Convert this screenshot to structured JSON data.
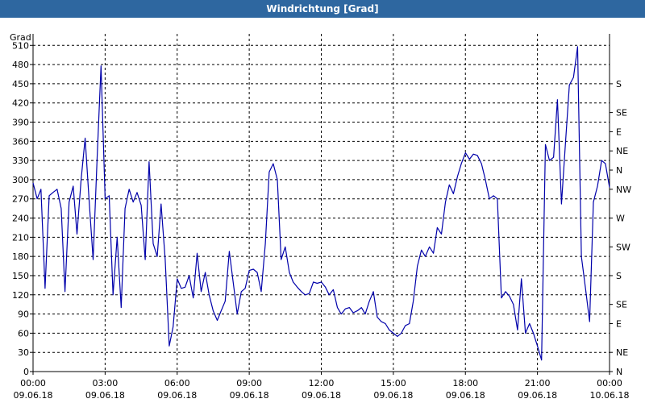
{
  "window": {
    "title": "Windrichtung [Grad]"
  },
  "chart_data": {
    "type": "line",
    "title": "Windrichtung [Grad]",
    "ylabel": "Grad",
    "ylim": [
      0,
      528
    ],
    "xlim_hours": [
      0,
      24
    ],
    "grid": true,
    "line_color": "#0000aa",
    "y_ticks": [
      0,
      30,
      60,
      90,
      120,
      150,
      180,
      210,
      240,
      270,
      300,
      330,
      360,
      390,
      420,
      450,
      480,
      510
    ],
    "right_ticks": [
      {
        "value": 0,
        "label": "N"
      },
      {
        "value": 30,
        "label": "NE"
      },
      {
        "value": 75,
        "label": "E"
      },
      {
        "value": 105,
        "label": "SE"
      },
      {
        "value": 150,
        "label": "S"
      },
      {
        "value": 195,
        "label": "SW"
      },
      {
        "value": 240,
        "label": "W"
      },
      {
        "value": 285,
        "label": "NW"
      },
      {
        "value": 315,
        "label": "N"
      },
      {
        "value": 345,
        "label": "NE"
      },
      {
        "value": 375,
        "label": "E"
      },
      {
        "value": 405,
        "label": "SE"
      },
      {
        "value": 450,
        "label": "S"
      }
    ],
    "x_ticks": [
      {
        "hour": 0,
        "time": "00:00",
        "date": "09.06.18"
      },
      {
        "hour": 3,
        "time": "03:00",
        "date": "09.06.18"
      },
      {
        "hour": 6,
        "time": "06:00",
        "date": "09.06.18"
      },
      {
        "hour": 9,
        "time": "09:00",
        "date": "09.06.18"
      },
      {
        "hour": 12,
        "time": "12:00",
        "date": "09.06.18"
      },
      {
        "hour": 15,
        "time": "15:00",
        "date": "09.06.18"
      },
      {
        "hour": 18,
        "time": "18:00",
        "date": "09.06.18"
      },
      {
        "hour": 21,
        "time": "21:00",
        "date": "09.06.18"
      },
      {
        "hour": 24,
        "time": "00:00",
        "date": "10.06.18"
      }
    ],
    "series": [
      {
        "points": [
          [
            0.0,
            295
          ],
          [
            0.17,
            270
          ],
          [
            0.33,
            285
          ],
          [
            0.5,
            130
          ],
          [
            0.67,
            275
          ],
          [
            0.83,
            280
          ],
          [
            1.0,
            285
          ],
          [
            1.17,
            255
          ],
          [
            1.33,
            125
          ],
          [
            1.5,
            265
          ],
          [
            1.67,
            290
          ],
          [
            1.83,
            215
          ],
          [
            2.0,
            300
          ],
          [
            2.17,
            365
          ],
          [
            2.33,
            270
          ],
          [
            2.5,
            175
          ],
          [
            2.67,
            335
          ],
          [
            2.83,
            478
          ],
          [
            3.0,
            270
          ],
          [
            3.17,
            275
          ],
          [
            3.33,
            120
          ],
          [
            3.5,
            210
          ],
          [
            3.67,
            100
          ],
          [
            3.83,
            255
          ],
          [
            4.0,
            285
          ],
          [
            4.17,
            265
          ],
          [
            4.33,
            280
          ],
          [
            4.5,
            260
          ],
          [
            4.67,
            175
          ],
          [
            4.83,
            328
          ],
          [
            5.0,
            200
          ],
          [
            5.17,
            180
          ],
          [
            5.33,
            262
          ],
          [
            5.5,
            175
          ],
          [
            5.67,
            40
          ],
          [
            5.83,
            70
          ],
          [
            6.0,
            145
          ],
          [
            6.17,
            130
          ],
          [
            6.33,
            132
          ],
          [
            6.5,
            150
          ],
          [
            6.67,
            115
          ],
          [
            6.83,
            185
          ],
          [
            7.0,
            125
          ],
          [
            7.17,
            155
          ],
          [
            7.33,
            120
          ],
          [
            7.5,
            95
          ],
          [
            7.67,
            80
          ],
          [
            7.83,
            95
          ],
          [
            8.0,
            110
          ],
          [
            8.17,
            188
          ],
          [
            8.33,
            140
          ],
          [
            8.5,
            90
          ],
          [
            8.67,
            125
          ],
          [
            8.83,
            130
          ],
          [
            9.0,
            158
          ],
          [
            9.17,
            160
          ],
          [
            9.33,
            155
          ],
          [
            9.5,
            125
          ],
          [
            9.67,
            200
          ],
          [
            9.83,
            312
          ],
          [
            10.0,
            325
          ],
          [
            10.17,
            300
          ],
          [
            10.33,
            175
          ],
          [
            10.5,
            195
          ],
          [
            10.67,
            155
          ],
          [
            10.83,
            140
          ],
          [
            11.0,
            132
          ],
          [
            11.17,
            125
          ],
          [
            11.33,
            120
          ],
          [
            11.5,
            122
          ],
          [
            11.67,
            140
          ],
          [
            11.83,
            138
          ],
          [
            12.0,
            140
          ],
          [
            12.17,
            132
          ],
          [
            12.33,
            120
          ],
          [
            12.5,
            128
          ],
          [
            12.67,
            100
          ],
          [
            12.83,
            90
          ],
          [
            13.0,
            98
          ],
          [
            13.17,
            100
          ],
          [
            13.33,
            92
          ],
          [
            13.5,
            95
          ],
          [
            13.67,
            100
          ],
          [
            13.83,
            90
          ],
          [
            14.0,
            110
          ],
          [
            14.17,
            125
          ],
          [
            14.33,
            85
          ],
          [
            14.5,
            78
          ],
          [
            14.67,
            75
          ],
          [
            14.83,
            65
          ],
          [
            15.0,
            60
          ],
          [
            15.17,
            55
          ],
          [
            15.33,
            60
          ],
          [
            15.5,
            72
          ],
          [
            15.67,
            75
          ],
          [
            15.83,
            110
          ],
          [
            16.0,
            165
          ],
          [
            16.17,
            190
          ],
          [
            16.33,
            180
          ],
          [
            16.5,
            195
          ],
          [
            16.67,
            185
          ],
          [
            16.83,
            225
          ],
          [
            17.0,
            215
          ],
          [
            17.17,
            265
          ],
          [
            17.33,
            292
          ],
          [
            17.5,
            278
          ],
          [
            17.67,
            305
          ],
          [
            17.83,
            325
          ],
          [
            18.0,
            342
          ],
          [
            18.17,
            332
          ],
          [
            18.33,
            340
          ],
          [
            18.5,
            338
          ],
          [
            18.67,
            325
          ],
          [
            18.83,
            300
          ],
          [
            19.0,
            270
          ],
          [
            19.17,
            275
          ],
          [
            19.33,
            270
          ],
          [
            19.5,
            115
          ],
          [
            19.67,
            125
          ],
          [
            19.83,
            118
          ],
          [
            20.0,
            105
          ],
          [
            20.17,
            65
          ],
          [
            20.33,
            145
          ],
          [
            20.5,
            60
          ],
          [
            20.67,
            75
          ],
          [
            20.83,
            60
          ],
          [
            21.0,
            40
          ],
          [
            21.17,
            18
          ],
          [
            21.33,
            355
          ],
          [
            21.5,
            330
          ],
          [
            21.67,
            335
          ],
          [
            21.83,
            425
          ],
          [
            22.0,
            262
          ],
          [
            22.17,
            360
          ],
          [
            22.33,
            448
          ],
          [
            22.5,
            460
          ],
          [
            22.67,
            508
          ],
          [
            22.83,
            180
          ],
          [
            23.0,
            130
          ],
          [
            23.17,
            78
          ],
          [
            23.33,
            265
          ],
          [
            23.5,
            290
          ],
          [
            23.67,
            330
          ],
          [
            23.83,
            325
          ],
          [
            24.0,
            288
          ]
        ]
      }
    ]
  }
}
